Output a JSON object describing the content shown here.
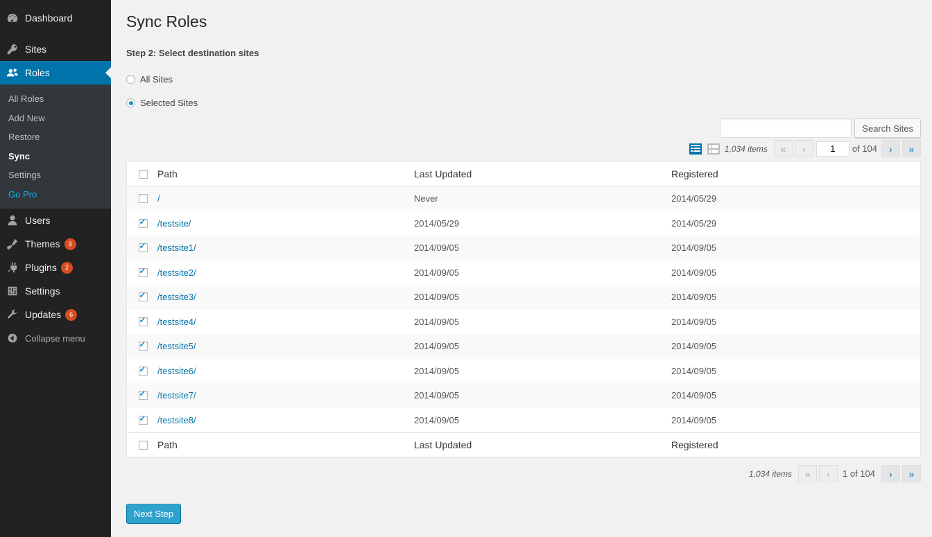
{
  "sidebar": {
    "top_items": [
      {
        "label": "Dashboard",
        "icon": "dashboard-icon"
      },
      {
        "label": "Sites",
        "icon": "sites-icon"
      },
      {
        "label": "Roles",
        "icon": "roles-icon"
      }
    ],
    "submenu": [
      "All Roles",
      "Add New",
      "Restore",
      "Sync",
      "Settings",
      "Go Pro"
    ],
    "bottom_items": [
      {
        "label": "Users",
        "icon": "users-icon",
        "badge": ""
      },
      {
        "label": "Themes",
        "icon": "themes-icon",
        "badge": "3"
      },
      {
        "label": "Plugins",
        "icon": "plugins-icon",
        "badge": "2"
      },
      {
        "label": "Settings",
        "icon": "settings-icon",
        "badge": ""
      },
      {
        "label": "Updates",
        "icon": "updates-icon",
        "badge": "6"
      }
    ],
    "collapse_label": "Collapse menu",
    "accent_color": "#0073aa"
  },
  "page": {
    "title": "Sync Roles",
    "step": "Step 2: Select destination sites",
    "radio_all": "All Sites",
    "radio_selected": "Selected Sites",
    "selected_option": "Selected Sites",
    "search_value": "",
    "search_button": "Search Sites",
    "next_button": "Next Step"
  },
  "pagination": {
    "items": "1,034 items",
    "current_page": "1",
    "of_total": "of 104",
    "bottom_page_label": "1 of 104",
    "first": "«",
    "prev": "‹",
    "next": "›",
    "last": "»"
  },
  "table": {
    "columns": [
      "Path",
      "Last Updated",
      "Registered"
    ],
    "rows": [
      {
        "checked": false,
        "path": "/",
        "last_updated": "Never",
        "registered": "2014/05/29"
      },
      {
        "checked": true,
        "path": "/testsite/",
        "last_updated": "2014/05/29",
        "registered": "2014/05/29"
      },
      {
        "checked": true,
        "path": "/testsite1/",
        "last_updated": "2014/09/05",
        "registered": "2014/09/05"
      },
      {
        "checked": true,
        "path": "/testsite2/",
        "last_updated": "2014/09/05",
        "registered": "2014/09/05"
      },
      {
        "checked": true,
        "path": "/testsite3/",
        "last_updated": "2014/09/05",
        "registered": "2014/09/05"
      },
      {
        "checked": true,
        "path": "/testsite4/",
        "last_updated": "2014/09/05",
        "registered": "2014/09/05"
      },
      {
        "checked": true,
        "path": "/testsite5/",
        "last_updated": "2014/09/05",
        "registered": "2014/09/05"
      },
      {
        "checked": true,
        "path": "/testsite6/",
        "last_updated": "2014/09/05",
        "registered": "2014/09/05"
      },
      {
        "checked": true,
        "path": "/testsite7/",
        "last_updated": "2014/09/05",
        "registered": "2014/09/05"
      },
      {
        "checked": true,
        "path": "/testsite8/",
        "last_updated": "2014/09/05",
        "registered": "2014/09/05"
      }
    ]
  }
}
